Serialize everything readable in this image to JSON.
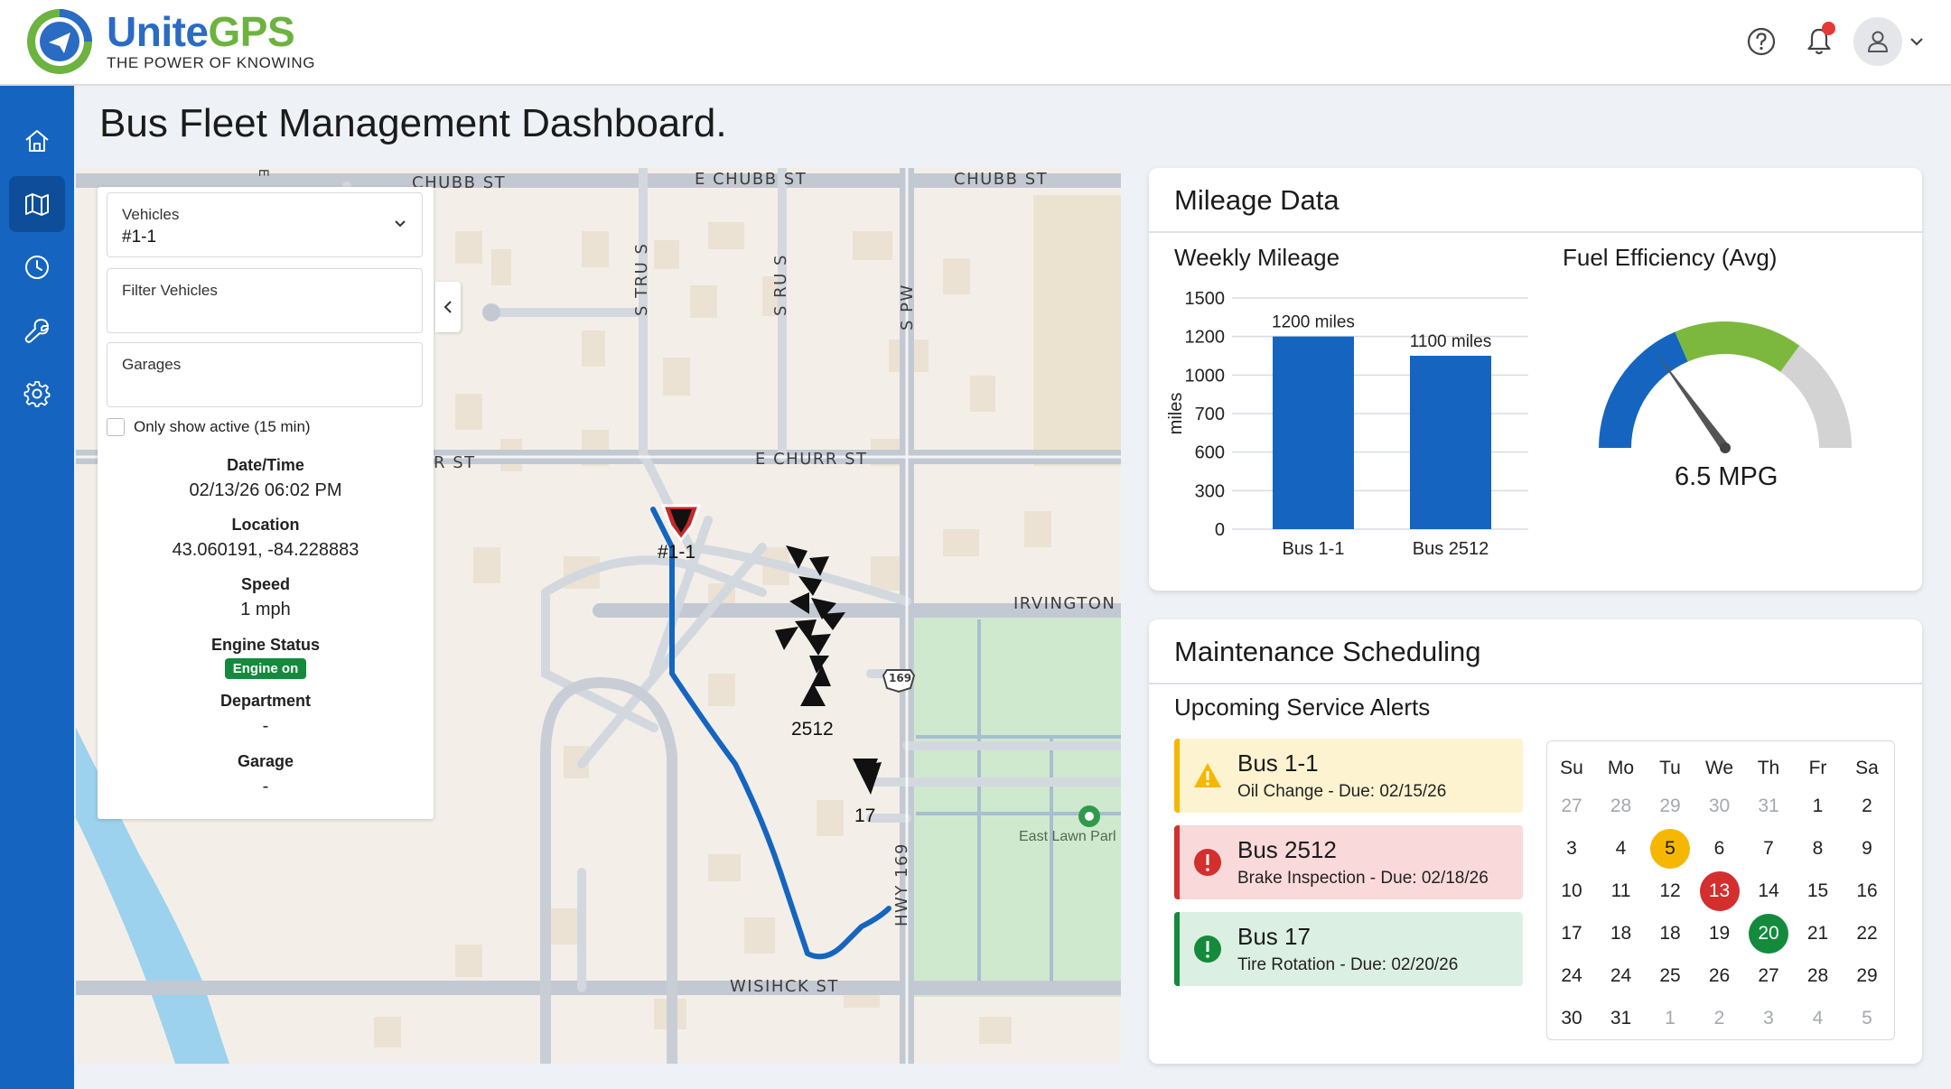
{
  "brand": {
    "name_part1": "Unite",
    "name_part2": "GPS",
    "tagline": "THE POWER OF KNOWING",
    "colors": {
      "blue": "#2a6bc4",
      "green": "#6cb33f"
    }
  },
  "header": {
    "icons": [
      "help-circle-icon",
      "bell-icon",
      "user-icon",
      "chevron-down-icon"
    ],
    "has_notification": true
  },
  "sidebar": {
    "items": [
      {
        "icon": "home-icon",
        "active": false
      },
      {
        "icon": "map-icon",
        "active": true
      },
      {
        "icon": "clock-icon",
        "active": false
      },
      {
        "icon": "wrench-icon",
        "active": false
      },
      {
        "icon": "gear-icon",
        "active": false
      }
    ],
    "color": "#1565c0"
  },
  "page": {
    "title": "Bus Fleet Management Dashboard."
  },
  "map": {
    "streets": {
      "chubb_left": "CHUBB ST",
      "e_chubb": "E CHUBB ST",
      "chubb_right": "CHUBB ST",
      "e_churr": "E CHURR ST",
      "r_st": "R ST",
      "irvington": "IRVINGTON",
      "wisihck": "WISIHCK ST",
      "s_tru": "S TRU S",
      "s_ru": "S RU S",
      "s_pw": "S PW",
      "hwy": "HWY 169",
      "shield": "169",
      "edge_mark": "E"
    },
    "park": "East Lawn Parl",
    "buses": [
      {
        "label": "#1-1",
        "color": "#c62828"
      },
      {
        "label": "2512",
        "color": "#111111"
      },
      {
        "label": "17",
        "color": "#111111"
      }
    ],
    "route_color": "#1565c0"
  },
  "panel": {
    "vehicles_label": "Vehicles",
    "vehicles_value": "#1-1",
    "filter_label": "Filter Vehicles",
    "garages_label": "Garages",
    "only_active_label": "Only show active (15 min)",
    "datetime_label": "Date/Time",
    "datetime_value": "02/13/26 06:02 PM",
    "location_label": "Location",
    "location_value": "43.060191, -84.228883",
    "speed_label": "Speed",
    "speed_value": "1 mph",
    "engine_label": "Engine Status",
    "engine_value": "Engine on",
    "department_label": "Department",
    "department_value": "-",
    "garage_label": "Garage",
    "garage_value": "-"
  },
  "mileage": {
    "title": "Mileage Data",
    "weekly_title": "Weekly Mileage",
    "fuel_title": "Fuel Efficiency (Avg)",
    "gauge_value": "6.5 MPG"
  },
  "chart_data": {
    "type": "bar",
    "title": "Weekly Mileage",
    "xlabel": "",
    "ylabel": "miles",
    "categories": [
      "Bus 1-1",
      "Bus 2512"
    ],
    "values": [
      1200,
      1100
    ],
    "data_labels": [
      "1200 miles",
      "1100 miles"
    ],
    "yticks": [
      "0",
      "300",
      "600",
      "700",
      "1000",
      "1200",
      "1500"
    ],
    "grid": true,
    "bar_color": "#1565c0"
  },
  "gauge": {
    "value_mpg": 6.5,
    "needle_fraction": 0.3,
    "segments": [
      {
        "color": "#1565c0"
      },
      {
        "color": "#7cb83e"
      },
      {
        "color": "#d3d3d3"
      }
    ]
  },
  "maintenance": {
    "title": "Maintenance Scheduling",
    "alerts_title": "Upcoming Service Alerts",
    "alerts": [
      {
        "bus": "Bus 1-1",
        "detail": "Oil Change - Due: 02/15/26",
        "level": "warning",
        "bg": "#fdf3d0",
        "bar": "#f5b700",
        "icon": "warning-triangle-icon"
      },
      {
        "bus": "Bus 2512",
        "detail": "Brake Inspection - Due: 02/18/26",
        "level": "critical",
        "bg": "#f9d9d9",
        "bar": "#d32f2f",
        "icon": "error-circle-icon"
      },
      {
        "bus": "Bus 17",
        "detail": "Tire Rotation - Due: 02/20/26",
        "level": "ok",
        "bg": "#dcefe3",
        "bar": "#148a3c",
        "icon": "info-circle-icon"
      }
    ]
  },
  "calendar": {
    "weekdays": [
      "Su",
      "Mo",
      "Tu",
      "We",
      "Th",
      "Fr",
      "Sa"
    ],
    "weeks": [
      [
        "27",
        "28",
        "29",
        "30",
        "31",
        "1",
        "2"
      ],
      [
        "3",
        "4",
        "5",
        "6",
        "7",
        "8",
        "9"
      ],
      [
        "10",
        "11",
        "12",
        "13",
        "14",
        "15",
        "16"
      ],
      [
        "17",
        "18",
        "18",
        "19",
        "20",
        "21",
        "22"
      ],
      [
        "24",
        "24",
        "25",
        "26",
        "27",
        "28",
        "29"
      ],
      [
        "30",
        "31",
        "1",
        "2",
        "3",
        "4",
        "5"
      ]
    ],
    "muted": [
      [
        0,
        0
      ],
      [
        0,
        1
      ],
      [
        0,
        2
      ],
      [
        0,
        3
      ],
      [
        0,
        4
      ],
      [
        5,
        2
      ],
      [
        5,
        3
      ],
      [
        5,
        4
      ],
      [
        5,
        5
      ],
      [
        5,
        6
      ]
    ],
    "highlights": [
      {
        "row": 1,
        "col": 2,
        "color": "#f5b700",
        "text_color": "#1b1b1b"
      },
      {
        "row": 2,
        "col": 3,
        "color": "#d32f2f",
        "text_color": "#ffffff"
      },
      {
        "row": 3,
        "col": 4,
        "color": "#148a3c",
        "text_color": "#ffffff"
      }
    ]
  }
}
